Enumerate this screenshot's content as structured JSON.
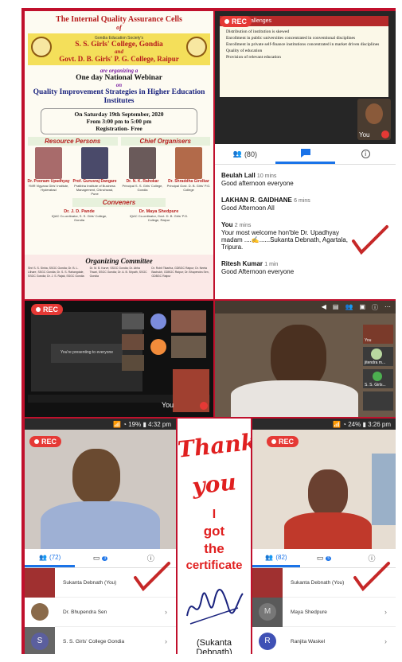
{
  "poster": {
    "line1": "The Internal Quality Assurance Cells",
    "of": "of",
    "society": "Gondia Education Society's",
    "college1": "S. S. Girls' College, Gondia",
    "and": "and",
    "college2": "Govt. D. B. Girls' P. G. College, Raipur",
    "organizing": "are organizing a",
    "webinar": "One day National Webinar",
    "on": "on",
    "topic": "Quality Improvement Strategies in Higher Education Institutes",
    "date": "On Saturday 19th September, 2020",
    "time": "From 3:00 pm to 5:00 pm",
    "registration": "Registration- Free",
    "resource_header": "Resource Persons",
    "chief_header": "Chief Organisers",
    "people": [
      {
        "name": "Dr. Poonam Upadhyay",
        "desc": "YMR Vigyana Girls' Institute, Hyderabad"
      },
      {
        "name": "Prof. Gurusraj Dangare",
        "desc": "Pratibha Institute of Business Management, Chinchwad, Pune"
      },
      {
        "name": "Dr. N. K. Rahokar",
        "desc": "Principal S. S. Girls' College, Gondia"
      },
      {
        "name": "Dr. Shraddha Girolkar",
        "desc": "Principal Govt. D. B. Girls' P.G. College"
      }
    ],
    "convener_header": "Conveners",
    "conveners": [
      {
        "name": "Dr. J. D. Pande",
        "desc": "IQAC Co-ordinator, S. S. Girls' College, Gondia"
      },
      {
        "name": "Dr. Maya Shedpure",
        "desc": "IQAC Co-ordinator, Govt. D. B. Girls' P.G. College, Raipur"
      }
    ],
    "committee_header": "Organizing Committee",
    "committee_col1": "Shri S. S. Sinha, SSGC Gondia; Dr. B. L. Lilhare, SSGC Gondia; Dr. S. S. Rahangdale, SSGC Gondia; Dr. J. S. Rajak, SSGC Gondia",
    "committee_col2": "Dr. M. B. Karve, SSGC Gondia; Dr. Abha Tiwari, SSGC Gondia; Dr. A. B. Sripath, SSGC Gondia",
    "committee_col3": "Dr. Rohit Tikariha, GDBGC Raipur; Dr. Neeta Bachukh, GDBGC Raipur; Dr. Bhupendra Sen, GDBGC Raipur"
  },
  "slide": {
    "rec": "REC",
    "heading": "Challenges",
    "bullets": [
      "Distribution of institution is skewed",
      "Enrollment in public universities concentrated in conventional disciplines",
      "Enrollment in private self-finance institutions concentrated in market driven disciplines",
      "Quality of education",
      "Provision of relevant education"
    ],
    "you_label": "You"
  },
  "chat": {
    "participants_count": "(80)",
    "messages": [
      {
        "name": "Beulah Lall",
        "time": "10 mins",
        "text": "Good afternoon everyone"
      },
      {
        "name": "LAKHAN R. GAIDHANE",
        "time": "6 mins",
        "text": "Good Afternoon All"
      },
      {
        "name": "You",
        "time": "2 mins",
        "text": "Your most welcome hon'ble Dr. Upadhyay madam ....✍️......Sukanta Debnath, Agartala, Tripura."
      },
      {
        "name": "Ritesh Kumar",
        "time": "1 min",
        "text": "Good Afternoon everyone"
      }
    ]
  },
  "zoom": {
    "rec": "REC",
    "waiting": "You're presenting to everyone",
    "you_label": "You"
  },
  "video": {
    "names": [
      "You",
      "jitendra m...",
      "S. S. Girls..."
    ]
  },
  "phone1": {
    "status": "📶 ◔ 19% ▮ 4:32 pm",
    "rec": "REC",
    "participants_count": "(72)",
    "badge": "3",
    "rows": [
      {
        "name": "Sukanta Debnath (You)"
      },
      {
        "name": "Dr. Bhupendra Sen"
      },
      {
        "name": "S. S. Girls' College Gondia"
      }
    ]
  },
  "thankyou": {
    "thank": "Thank",
    "you": "you",
    "i": "I",
    "got": "got",
    "the": "the",
    "certificate": "certificate",
    "name": "(Sukanta Debnath)"
  },
  "phone2": {
    "status": "📶 ◔ 24% ▮ 3:26 pm",
    "rec": "REC",
    "participants_count": "(82)",
    "badge": "5",
    "rows": [
      {
        "name": "Sukanta Debnath (You)",
        "letter": ""
      },
      {
        "name": "Maya Shedpure",
        "letter": "M"
      },
      {
        "name": "Ranjita Waskel",
        "letter": "R"
      }
    ]
  },
  "colors": {
    "frame": "#c0102c",
    "rec": "#e53935",
    "tab_active": "#1a73e8",
    "check": "#c62828"
  }
}
